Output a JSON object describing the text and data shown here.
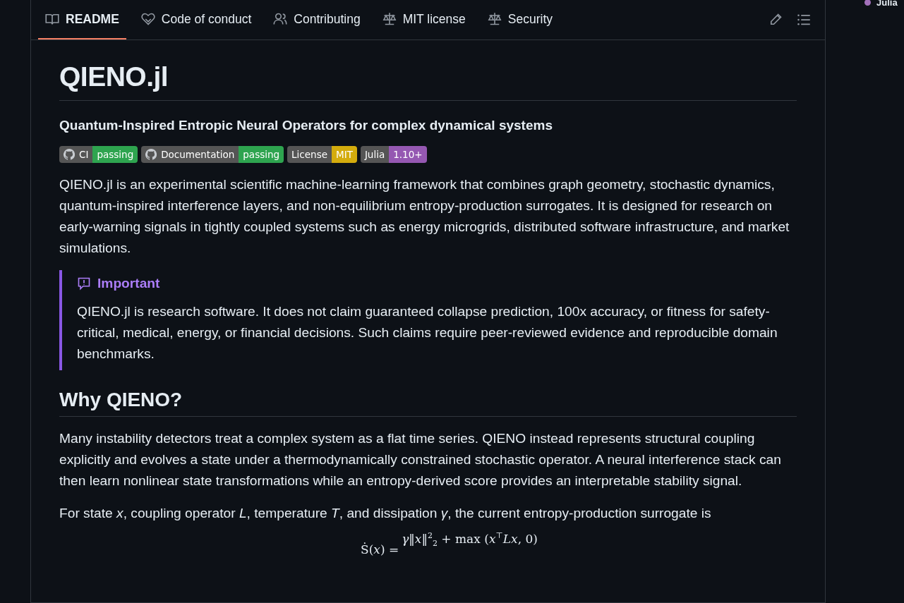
{
  "tabs": [
    {
      "label": "README",
      "selected": true
    },
    {
      "label": "Code of conduct",
      "selected": false
    },
    {
      "label": "Contributing",
      "selected": false
    },
    {
      "label": "MIT license",
      "selected": false
    },
    {
      "label": "Security",
      "selected": false
    }
  ],
  "sidebar": {
    "language": {
      "name": "Julia",
      "color": "#a270ba"
    }
  },
  "readme": {
    "title": "QIENO.jl",
    "subtitle": "Quantum-Inspired Entropic Neural Operators for complex dynamical systems",
    "badges": [
      {
        "label": "CI",
        "value": "passing",
        "github": true,
        "color": "#2ea44f"
      },
      {
        "label": "Documentation",
        "value": "passing",
        "github": true,
        "color": "#2ea44f"
      },
      {
        "label": "License",
        "value": "MIT",
        "github": false,
        "color": "#d4ac0d"
      },
      {
        "label": "Julia",
        "value": "1.10+",
        "github": false,
        "color": "#9558b2"
      }
    ],
    "intro": "QIENO.jl is an experimental scientific machine-learning framework that combines graph geometry, stochastic dynamics, quantum-inspired interference layers, and non-equilibrium entropy-production surrogates. It is designed for research on early-warning signals in tightly coupled systems such as energy microgrids, distributed software infrastructure, and market simulations.",
    "alert": {
      "kind": "important",
      "title": "Important",
      "text": "QIENO.jl is research software. It does not claim guaranteed collapse prediction, 100x accuracy, or fitness for safety-critical, medical, energy, or financial decisions. Such claims require peer-reviewed evidence and reproducible domain benchmarks."
    },
    "section": {
      "heading": "Why QIENO?",
      "paragraphs": [
        "Many instability detectors treat a complex system as a flat time series. QIENO instead represents structural coupling explicitly and evolves a state under a thermodynamically constrained stochastic operator. A neural interference stack can then learn nonlinear state transformations while an entropy-derived score provides an interpretable stability signal.",
        "For state *x*, coupling operator *L*, temperature *T*, and dissipation *γ*, the current entropy-production surrogate is"
      ]
    },
    "formula": {
      "lhs": "Ṡ(*x*) =",
      "numerator": "*γ*‖*x*‖$^{2}$$_{2}$ +  max (*x*$^{⊤}$*Lx*, 0)"
    }
  }
}
